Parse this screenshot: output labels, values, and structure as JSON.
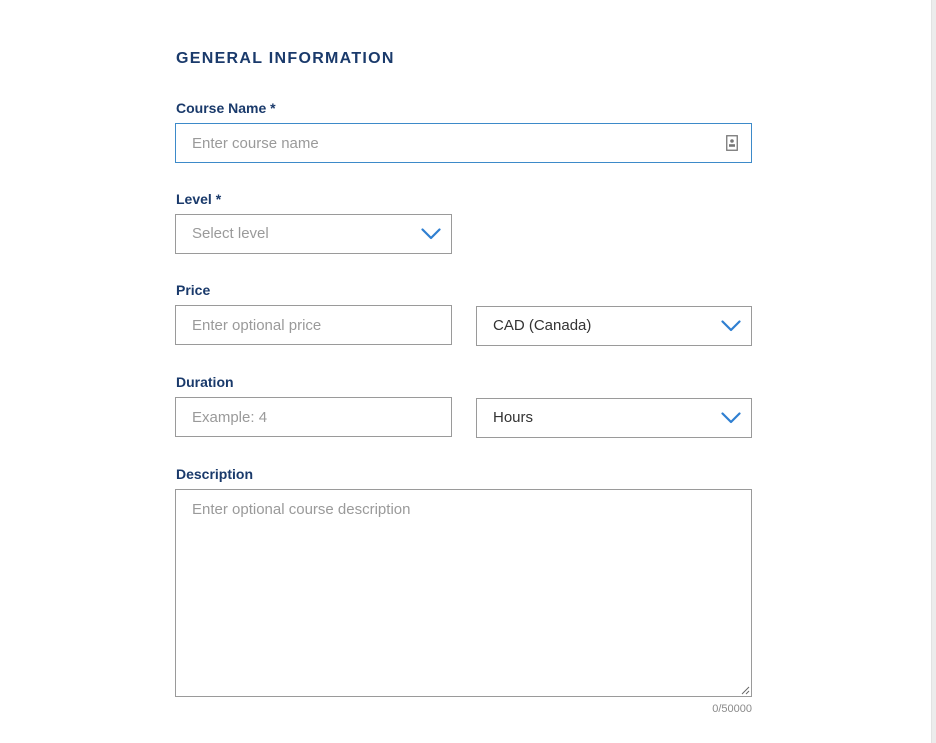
{
  "section": {
    "title": "GENERAL INFORMATION"
  },
  "course_name": {
    "label": "Course Name *",
    "placeholder": "Enter course name",
    "icon": "contact-card-icon"
  },
  "level": {
    "label": "Level *",
    "placeholder": "Select level",
    "icon": "chevron-down-icon"
  },
  "price": {
    "label": "Price",
    "placeholder": "Enter optional price",
    "currency_value": "CAD (Canada)",
    "icon": "chevron-down-icon"
  },
  "duration": {
    "label": "Duration",
    "placeholder": "Example: 4",
    "unit_value": "Hours",
    "icon": "chevron-down-icon"
  },
  "description": {
    "label": "Description",
    "placeholder": "Enter optional course description",
    "counter": "0/50000"
  },
  "colors": {
    "heading": "#1a3a6b",
    "focus_border": "#3d8ac9",
    "chevron": "#2f7fd1",
    "border": "#9a9a9a"
  }
}
